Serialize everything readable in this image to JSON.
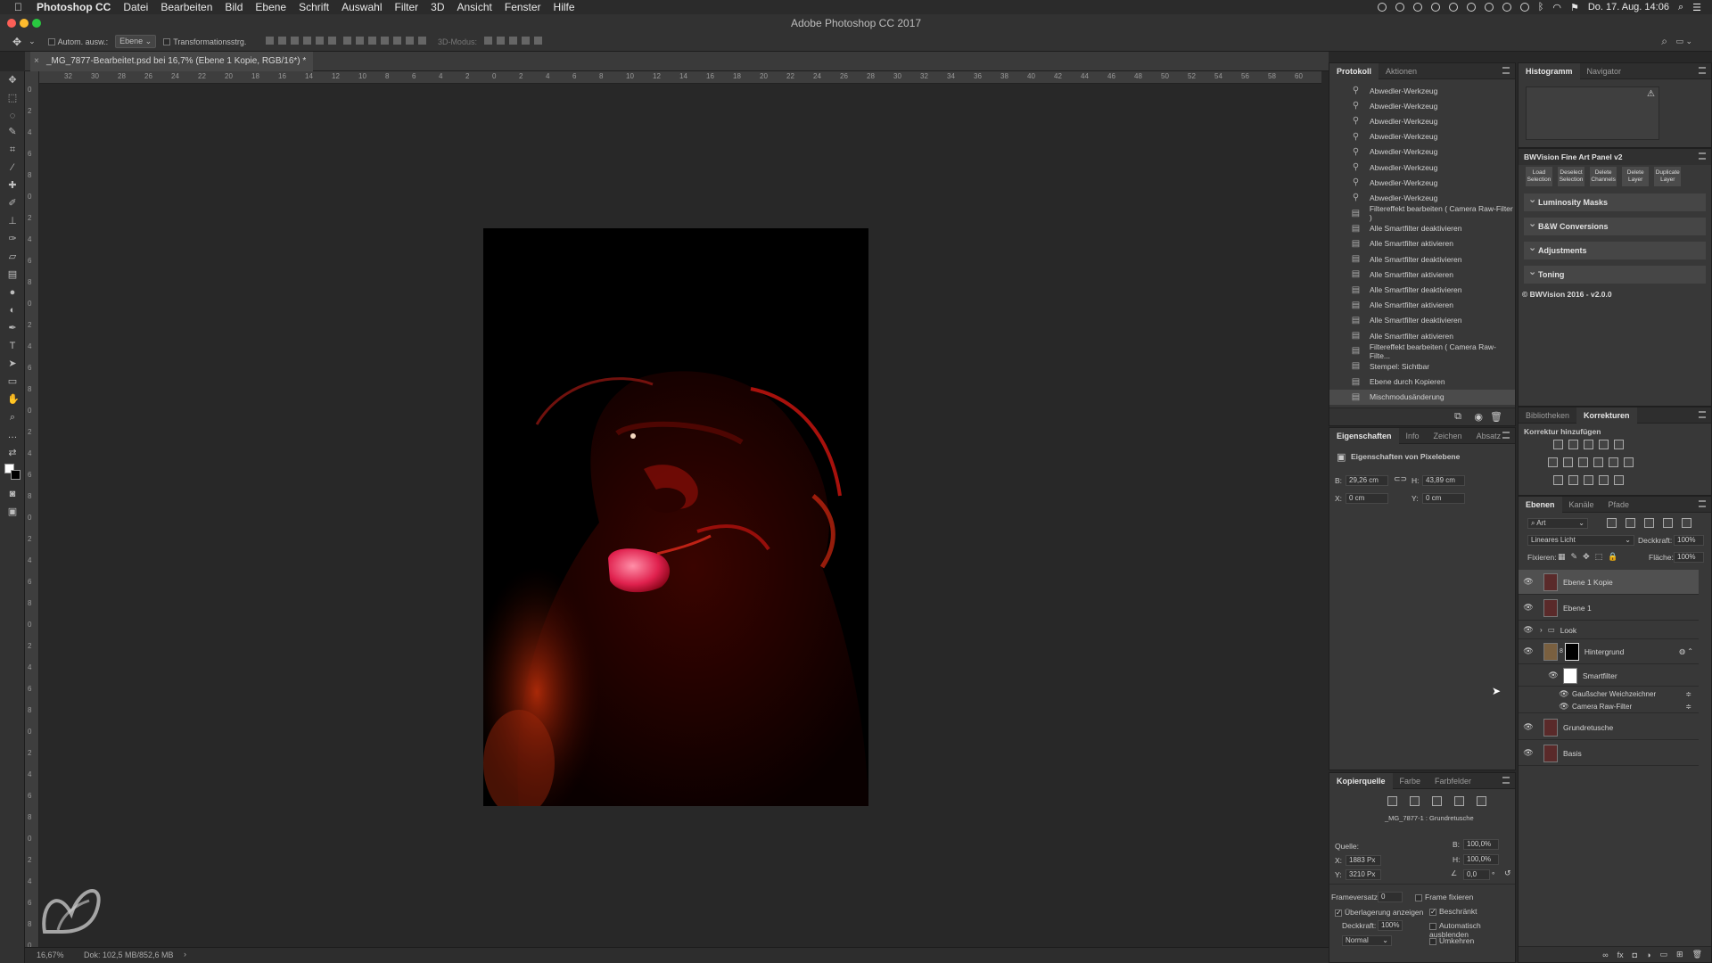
{
  "menubar": {
    "app": "Photoshop CC",
    "items": [
      "Datei",
      "Bearbeiten",
      "Bild",
      "Ebene",
      "Schrift",
      "Auswahl",
      "Filter",
      "3D",
      "Ansicht",
      "Fenster",
      "Hilfe"
    ],
    "datetime": "Do. 17. Aug. 14:06"
  },
  "window": {
    "title": "Adobe Photoshop CC 2017"
  },
  "options": {
    "auto_select_label": "Autom. ausw.:",
    "auto_select_target": "Ebene",
    "transform_label": "Transformationsstrg.",
    "mode3d_label": "3D-Modus:"
  },
  "document": {
    "tab_title": "_MG_7877-Bearbeitet.psd bei 16,7% (Ebene 1 Kopie, RGB/16*) *",
    "ruler_top": [
      "32",
      "30",
      "28",
      "26",
      "24",
      "22",
      "20",
      "18",
      "16",
      "14",
      "12",
      "10",
      "8",
      "6",
      "4",
      "2",
      "0",
      "2",
      "4",
      "6",
      "8",
      "10",
      "12",
      "14",
      "16",
      "18",
      "20",
      "22",
      "24",
      "26",
      "28",
      "30",
      "32",
      "34",
      "36",
      "38",
      "40",
      "42",
      "44",
      "46",
      "48",
      "50",
      "52",
      "54",
      "56",
      "58",
      "60",
      "62"
    ],
    "ruler_left": [
      "0",
      "2",
      "4",
      "6",
      "8",
      "0",
      "2",
      "4",
      "6",
      "8",
      "0",
      "2",
      "4",
      "6",
      "8",
      "0",
      "2",
      "4",
      "6",
      "8",
      "0",
      "2",
      "4",
      "6",
      "8",
      "0",
      "2",
      "4",
      "6",
      "8",
      "0",
      "2",
      "4",
      "6",
      "8",
      "0",
      "2",
      "4",
      "6",
      "8",
      "0"
    ],
    "zoom": "16,67%",
    "doc_size": "Dok: 102,5 MB/852,6 MB"
  },
  "history_panel": {
    "tabs": [
      "Protokoll",
      "Aktionen"
    ],
    "items": [
      "Abwedler-Werkzeug",
      "Abwedler-Werkzeug",
      "Abwedler-Werkzeug",
      "Abwedler-Werkzeug",
      "Abwedler-Werkzeug",
      "Abwedler-Werkzeug",
      "Abwedler-Werkzeug",
      "Abwedler-Werkzeug",
      "Filtereffekt bearbeiten ( Camera Raw-Filter )",
      "Alle Smartfilter deaktivieren",
      "Alle Smartfilter aktivieren",
      "Alle Smartfilter deaktivieren",
      "Alle Smartfilter aktivieren",
      "Alle Smartfilter deaktivieren",
      "Alle Smartfilter aktivieren",
      "Alle Smartfilter deaktivieren",
      "Alle Smartfilter aktivieren",
      "Filtereffekt bearbeiten ( Camera Raw-Filte...",
      "Stempel: Sichtbar",
      "Ebene durch Kopieren",
      "Mischmodusänderung"
    ]
  },
  "properties_panel": {
    "tabs": [
      "Eigenschaften",
      "Info",
      "Zeichen",
      "Absatz"
    ],
    "heading": "Eigenschaften von Pixelebene",
    "b_label": "B:",
    "b_value": "29,26 cm",
    "h_label": "H:",
    "h_value": "43,89 cm",
    "x_label": "X:",
    "x_value": "0 cm",
    "y_label": "Y:",
    "y_value": "0 cm"
  },
  "clone_panel": {
    "tabs": [
      "Kopierquelle",
      "Farbe",
      "Farbfelder"
    ],
    "source_name": "_MG_7877-1 : Grundretusche",
    "quelle_label": "Quelle:",
    "x_label": "X:",
    "x_value": "1883 Px",
    "y_label": "Y:",
    "y_value": "3210 Px",
    "w_label": "B:",
    "w_value": "100,0%",
    "h_label": "H:",
    "h_value": "100,0%",
    "angle_value": "0,0",
    "angle_unit": "°",
    "frame_offset_label": "Frameversatz:",
    "frame_offset_value": "0",
    "frame_lock_label": "Frame fixieren",
    "overlay_label": "Überlagerung anzeigen",
    "clipped_label": "Beschränkt",
    "opacity_label": "Deckkraft:",
    "opacity_value": "100%",
    "auto_hide_label": "Automatisch ausblenden",
    "blend_value": "Normal",
    "invert_label": "Umkehren"
  },
  "histogram_panel": {
    "tabs": [
      "Histogramm",
      "Navigator"
    ]
  },
  "bwvision_panel": {
    "title": "BWVision Fine Art Panel v2",
    "buttons": [
      [
        "Load",
        "Selection"
      ],
      [
        "Deselect",
        "Selection"
      ],
      [
        "Delete",
        "Channels"
      ],
      [
        "Delete",
        "Layer"
      ],
      [
        "Duplicate",
        "Layer"
      ]
    ],
    "sections": [
      "Luminosity Masks",
      "B&W Conversions",
      "Adjustments",
      "Toning"
    ],
    "footer": "© BWVision 2016 - v2.0.0"
  },
  "adjustments_panel": {
    "tabs": [
      "Bibliotheken",
      "Korrekturen"
    ],
    "heading": "Korrektur hinzufügen"
  },
  "layers_panel": {
    "tabs": [
      "Ebenen",
      "Kanäle",
      "Pfade"
    ],
    "filter_label": "Art",
    "blend_mode": "Lineares Licht",
    "opacity_label": "Deckkraft:",
    "opacity_value": "100%",
    "lock_label": "Fixieren:",
    "fill_label": "Fläche:",
    "fill_value": "100%",
    "layers": [
      {
        "name": "Ebene 1 Kopie",
        "selected": true
      },
      {
        "name": "Ebene 1",
        "selected": false
      },
      {
        "name": "Look",
        "selected": false
      },
      {
        "name": "Hintergrund",
        "selected": false
      },
      {
        "name": "Smartfilter",
        "selected": false
      },
      {
        "name": "Gaußscher Weichzeichner",
        "selected": false
      },
      {
        "name": "Camera Raw-Filter",
        "selected": false
      },
      {
        "name": "Grundretusche",
        "selected": false
      },
      {
        "name": "Basis",
        "selected": false
      }
    ]
  },
  "colors": {
    "accent_red": "#c4140e",
    "panel_bg": "#383838",
    "workspace": "#282828"
  }
}
